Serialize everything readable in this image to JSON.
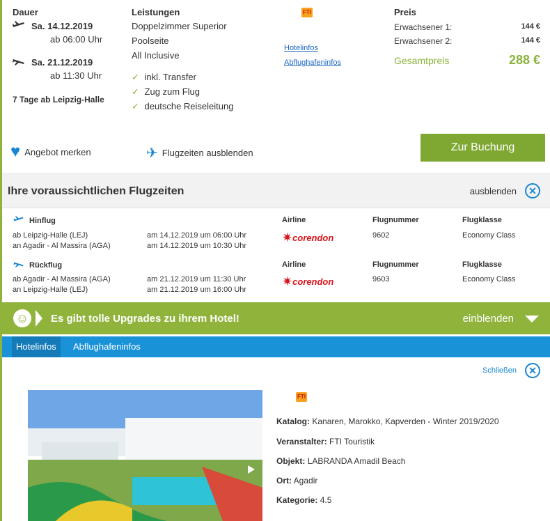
{
  "offer": {
    "dauer_label": "Dauer",
    "outbound_date": "Sa. 14.12.2019",
    "outbound_time": "ab 06:00 Uhr",
    "return_date": "Sa. 21.12.2019",
    "return_time": "ab 11:30 Uhr",
    "duration": "7 Tage ab Leipzig-Halle",
    "leistungen_label": "Leistungen",
    "room": "Doppelzimmer Superior",
    "room_view": "Poolseite",
    "board": "All Inclusive",
    "extras": [
      "inkl. Transfer",
      "Zug zum Flug",
      "deutsche Reiseleitung"
    ],
    "link_hotel": "Hotelinfos",
    "link_airport": "Abflughafeninfos",
    "preis_label": "Preis",
    "adult1_label": "Erwachsener 1:",
    "adult1_price": "144 €",
    "adult2_label": "Erwachsener 2:",
    "adult2_price": "144 €",
    "total_label": "Gesamtpreis",
    "total_price": "288 €",
    "merken": "Angebot merken",
    "flugzeiten_toggle": "Flugzeiten ausblenden",
    "book_button": "Zur Buchung",
    "fti_logo": "FTI"
  },
  "flights": {
    "title": "Ihre voraussichtlichen Flugzeiten",
    "hide": "ausblenden",
    "outbound": {
      "label": "Hinflug",
      "from": "ab Leipzig-Halle (LEJ)",
      "to": "an Agadir - Al Massira (AGA)",
      "dep": "am 14.12.2019 um 06:00 Uhr",
      "arr": "am 14.12.2019 um 10:30 Uhr",
      "airline_label": "Airline",
      "airline": "corendon",
      "flightno_label": "Flugnummer",
      "flightno": "9602",
      "class_label": "Flugklasse",
      "class": "Economy Class"
    },
    "return": {
      "label": "Rückflug",
      "from": "ab Agadir - Al Massira (AGA)",
      "to": "an Leipzig-Halle (LEJ)",
      "dep": "am 21.12.2019 um 11:30 Uhr",
      "arr": "am 21.12.2019 um 16:00 Uhr",
      "airline_label": "Airline",
      "airline": "corendon",
      "flightno_label": "Flugnummer",
      "flightno": "9603",
      "class_label": "Flugklasse",
      "class": "Economy Class"
    }
  },
  "upgrades": {
    "text": "Es gibt tolle Upgrades zu ihrem Hotel!",
    "show": "einblenden"
  },
  "tabs": [
    "Hotelinfos",
    "Abflughafeninfos"
  ],
  "hotel": {
    "close": "Schließen",
    "katalog_label": "Katalog:",
    "katalog": "Kanaren, Marokko, Kapverden - Winter 2019/2020",
    "veranstalter_label": "Veranstalter:",
    "veranstalter": "FTI Touristik",
    "objekt_label": "Objekt:",
    "objekt": "LABRANDA Amadil Beach",
    "ort_label": "Ort:",
    "ort": "Agadir",
    "kategorie_label": "Kategorie:",
    "kategorie": "4.5"
  },
  "colors": {
    "green": "#8fb33b",
    "blue": "#1a92d8",
    "corendon_red": "#d7141a"
  }
}
